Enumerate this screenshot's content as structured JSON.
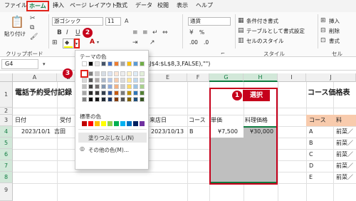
{
  "menu": [
    "ファイル",
    "ホーム",
    "挿入",
    "ページ レイアウト",
    "数式",
    "データ",
    "校閲",
    "表示",
    "ヘルプ"
  ],
  "ribbon": {
    "paste_label": "貼り付け",
    "clipboard_group": "クリップボード",
    "font_name": "游ゴシック",
    "font_size": "11",
    "number_format": "通貨",
    "conditional_format": "条件付き書式",
    "table_format": "テーブルとして書式設定",
    "cell_style": "セルのスタイル",
    "style_group": "スタイル",
    "insert": "挿入",
    "delete": "削除",
    "format": "書式",
    "cell_group": "セル",
    "percent": "%",
    "digits_inc": ".00",
    "digits_dec": ".0"
  },
  "formula_bar": {
    "name_box": "G4",
    "formula_fragment": "KUP(F4,$J$4:$L$8,3,FALSE),\"\")"
  },
  "columns": [
    "A",
    "B",
    "C",
    "D",
    "E",
    "F",
    "G",
    "H",
    "I",
    "J"
  ],
  "rows": [
    "1",
    "2",
    "3",
    "4",
    "5",
    "6",
    "7",
    "8",
    "9"
  ],
  "sheet": {
    "title": "電話予約受付記録",
    "headers": {
      "date": "日付",
      "reception": "受付",
      "visit_date": "来店日",
      "course": "コース",
      "unit_price": "単価",
      "price": "料理価格"
    },
    "row4": {
      "date": "2023/10/1",
      "reception": "吉田",
      "visit_date": "2023/10/13",
      "course": "B",
      "unit_price": "¥7,500",
      "price": "¥30,000"
    },
    "right_table": {
      "title": "コース価格表",
      "header_course": "コース",
      "header_item": "料",
      "courses": [
        "A",
        "B",
        "C",
        "D",
        "E"
      ],
      "items": [
        "前菜／",
        "前菜／",
        "前菜／",
        "前菜／",
        "前菜／"
      ]
    }
  },
  "palette": {
    "theme_title": "テーマの色",
    "standard_title": "標準の色",
    "no_fill": "塗りつぶしなし(N)",
    "more_colors": "その他の色(M)..."
  },
  "callouts": {
    "step1": "1",
    "step2": "2",
    "step3": "3",
    "select_label": "選択"
  },
  "colors": {
    "accent_red": "#c6001b",
    "excel_green": "#107c41",
    "selection_gray": "#bfbfbf",
    "header_peach": "#f8cbad"
  }
}
